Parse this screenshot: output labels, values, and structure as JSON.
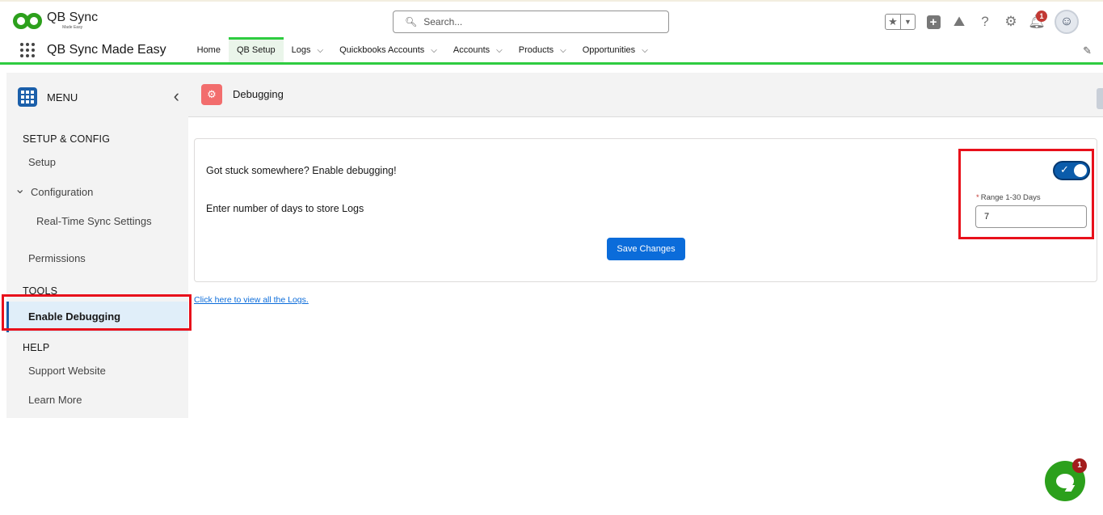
{
  "brand": {
    "title": "QB Sync",
    "subtitle": "Made Easy"
  },
  "search": {
    "placeholder": "Search..."
  },
  "header_icons": [
    "star-icon",
    "chevron-down-icon",
    "plus-icon",
    "trailhead-icon",
    "help-icon",
    "gear-icon",
    "bell-icon",
    "avatar"
  ],
  "notifications": {
    "count": "1"
  },
  "app": {
    "name": "QB Sync Made Easy"
  },
  "nav": {
    "items": [
      {
        "label": "Home",
        "has_menu": false
      },
      {
        "label": "QB Setup",
        "has_menu": false,
        "active": true
      },
      {
        "label": "Logs",
        "has_menu": true
      },
      {
        "label": "Quickbooks Accounts",
        "has_menu": true
      },
      {
        "label": "Accounts",
        "has_menu": true
      },
      {
        "label": "Products",
        "has_menu": true
      },
      {
        "label": "Opportunities",
        "has_menu": true
      }
    ]
  },
  "sidebar": {
    "menu_label": "MENU",
    "sections": {
      "setup": "SETUP & CONFIG",
      "tools": "TOOLS",
      "help": "HELP"
    },
    "items": {
      "setup": "Setup",
      "configuration": "Configuration",
      "realtime": "Real-Time Sync Settings",
      "permissions": "Permissions",
      "enable_debugging": "Enable Debugging",
      "support": "Support Website",
      "learn_more": "Learn More"
    }
  },
  "page": {
    "title": "Debugging"
  },
  "debug": {
    "question": "Got stuck somewhere? Enable debugging!",
    "days_prompt": "Enter number of days to store Logs",
    "toggle_on": true,
    "field_label": "Range 1-30 Days",
    "field_required_mark": "*",
    "days_value": "7",
    "save_label": "Save Changes"
  },
  "logs_link": "Click here to view all the Logs.",
  "chat": {
    "badge": "1"
  },
  "colors": {
    "brand_green": "#2ca01c",
    "primary_blue": "#0b6cda",
    "highlight_red": "#e8101b"
  }
}
